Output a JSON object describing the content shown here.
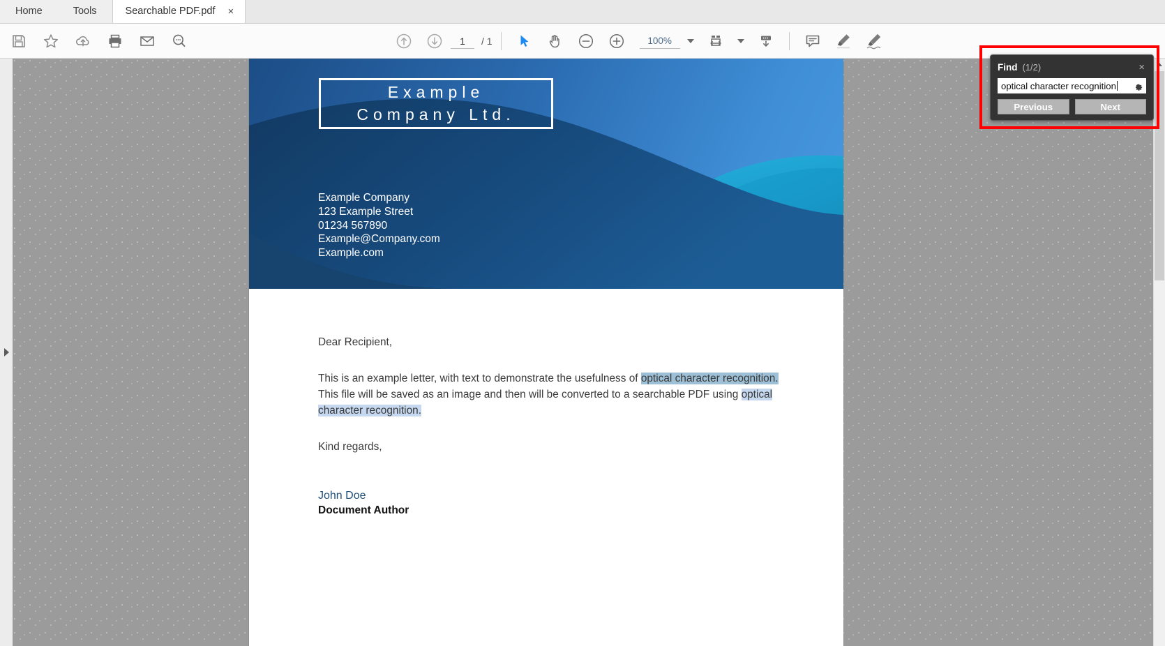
{
  "tabs": {
    "home": "Home",
    "tools": "Tools",
    "document": "Searchable PDF.pdf",
    "close_label": "×"
  },
  "toolbar": {
    "left_icons": [
      "save-icon",
      "star-icon",
      "cloud-upload-icon",
      "print-icon",
      "email-icon",
      "search-zoom-icon"
    ],
    "page_current": "1",
    "page_separator": "/ 1",
    "page_total": "1",
    "zoom_level": "100%",
    "center_icons": [
      "page-up-icon",
      "page-down-icon",
      "select-cursor-icon",
      "hand-tool-icon",
      "zoom-out-icon",
      "zoom-in-icon",
      "fit-width-icon",
      "scroll-mode-icon",
      "comment-icon",
      "highlight-icon",
      "sign-icon"
    ]
  },
  "document": {
    "letterhead": {
      "title_line1": "Example",
      "title_line2": "Company Ltd.",
      "contact": [
        "Example Company",
        "123 Example Street",
        "01234 567890",
        "Example@Company.com",
        "Example.com"
      ]
    },
    "body": {
      "salutation": "Dear Recipient,",
      "para1_part1": "This is an example letter, with text to demonstrate the usefulness of ",
      "para1_match1": "optical character recognition.",
      "para1_part2": " This file will be saved as an image and then will be converted to a searchable PDF using ",
      "para1_match2": "optical character recognition.",
      "closing": "Kind regards,",
      "signature_name": "John Doe",
      "signature_role": "Document Author"
    }
  },
  "find_panel": {
    "title": "Find",
    "count": "(1/2)",
    "close": "×",
    "query": "optical character recognition",
    "previous_label": "Previous",
    "next_label": "Next",
    "highlight_border_color": "#ff0000",
    "panel_bg": "#333333",
    "active_match_color": "#9dc0d6",
    "match_color": "#c5d8ef"
  }
}
